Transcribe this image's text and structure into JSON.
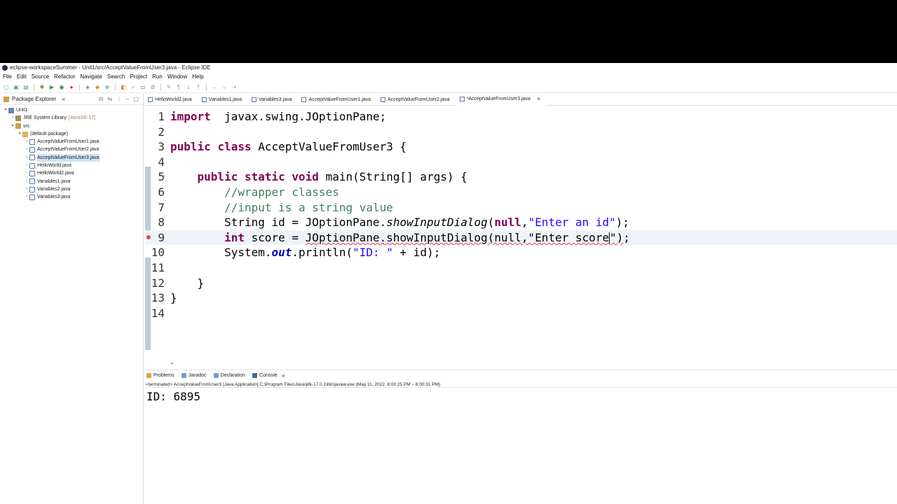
{
  "window": {
    "title": "eclipse-workspaceSummer - Unit1/src/AcceptValueFromUser3.java - Eclipse IDE"
  },
  "menu": [
    "File",
    "Edit",
    "Source",
    "Refactor",
    "Navigate",
    "Search",
    "Project",
    "Run",
    "Window",
    "Help"
  ],
  "explorer": {
    "title": "Package Explorer",
    "tree": [
      {
        "label": "Unit1",
        "indent": 0,
        "arrow": "▾",
        "icon": "project-icon"
      },
      {
        "label": "JRE System Library",
        "note": "[JavaSE-17]",
        "indent": 1,
        "arrow": "›",
        "icon": "library-icon"
      },
      {
        "label": "src",
        "indent": 1,
        "arrow": "▾",
        "icon": "source-folder-icon"
      },
      {
        "label": "(default package)",
        "indent": 2,
        "arrow": "▾",
        "icon": "package-icon"
      },
      {
        "label": "AcceptValueFromUser1.java",
        "indent": 3,
        "arrow": "›",
        "icon": "java-file-icon"
      },
      {
        "label": "AcceptValueFromUser2.java",
        "indent": 3,
        "arrow": "›",
        "icon": "java-file-icon"
      },
      {
        "label": "AcceptValueFromUser3.java",
        "indent": 3,
        "arrow": "›",
        "icon": "java-file-icon",
        "selected": true
      },
      {
        "label": "HelloWorld.java",
        "indent": 3,
        "arrow": "›",
        "icon": "java-file-icon"
      },
      {
        "label": "HelloWorld2.java",
        "indent": 3,
        "arrow": "›",
        "icon": "java-file-icon"
      },
      {
        "label": "Variables1.java",
        "indent": 3,
        "arrow": "›",
        "icon": "java-file-icon"
      },
      {
        "label": "Variables2.java",
        "indent": 3,
        "arrow": "›",
        "icon": "java-file-icon"
      },
      {
        "label": "Variables3.java",
        "indent": 3,
        "arrow": "›",
        "icon": "java-file-icon"
      }
    ]
  },
  "editor_tabs": [
    {
      "label": "HelloWorld2.java",
      "active": false
    },
    {
      "label": "Variables1.java",
      "active": false
    },
    {
      "label": "Variables3.java",
      "active": false
    },
    {
      "label": "AcceptValueFromUser1.java",
      "active": false
    },
    {
      "label": "AcceptValueFromUser2.java",
      "active": false
    },
    {
      "label": "*AcceptValueFromUser3.java",
      "active": true
    }
  ],
  "code": {
    "current_line": 9,
    "error_line": 9,
    "lines": [
      {
        "n": "1",
        "tokens": [
          [
            "kw",
            "import"
          ],
          [
            "",
            "  javax.swing.JOptionPane;"
          ]
        ]
      },
      {
        "n": "2",
        "tokens": []
      },
      {
        "n": "3",
        "tokens": [
          [
            "kw",
            "public"
          ],
          [
            "",
            " "
          ],
          [
            "kw",
            "class"
          ],
          [
            "",
            " AcceptValueFromUser3 {"
          ]
        ]
      },
      {
        "n": "4",
        "tokens": []
      },
      {
        "n": "5",
        "fold": true,
        "tokens": [
          [
            "",
            "    "
          ],
          [
            "kw",
            "public"
          ],
          [
            "",
            " "
          ],
          [
            "kw",
            "static"
          ],
          [
            "",
            " "
          ],
          [
            "kw",
            "void"
          ],
          [
            "",
            " main(String[] args) {"
          ]
        ]
      },
      {
        "n": "6",
        "tokens": [
          [
            "",
            "        "
          ],
          [
            "cm",
            "//wrapper classes"
          ]
        ]
      },
      {
        "n": "7",
        "tokens": [
          [
            "",
            "        "
          ],
          [
            "cm",
            "//input is a string value"
          ]
        ]
      },
      {
        "n": "8",
        "tokens": [
          [
            "",
            "        String id = JOptionPane."
          ],
          [
            "it",
            "showInputDialog"
          ],
          [
            "",
            "("
          ],
          [
            "kw",
            "null"
          ],
          [
            "",
            ","
          ],
          [
            "st",
            "\"Enter an id\""
          ],
          [
            "",
            ");"
          ]
        ]
      },
      {
        "n": "9",
        "tokens": [
          [
            "",
            "        "
          ],
          [
            "kw",
            "int"
          ],
          [
            "",
            " score = "
          ],
          [
            "squig",
            "JOptionPane.showInputDialog(null,\"Enter score"
          ],
          [
            "caret",
            ""
          ],
          [
            "squig",
            "\")"
          ],
          [
            "",
            ";"
          ]
        ]
      },
      {
        "n": "10",
        "tokens": [
          [
            "",
            "        System."
          ],
          [
            "fd",
            "out"
          ],
          [
            "",
            ".println("
          ],
          [
            "st",
            "\"ID: \""
          ],
          [
            "",
            " + id);"
          ]
        ]
      },
      {
        "n": "11",
        "tokens": []
      },
      {
        "n": "12",
        "tokens": [
          [
            "",
            "    }"
          ]
        ]
      },
      {
        "n": "13",
        "tokens": [
          [
            "",
            "}"
          ]
        ]
      },
      {
        "n": "14",
        "tokens": []
      }
    ]
  },
  "console_tabs": [
    {
      "label": "Problems",
      "icon": "problems-icon",
      "color": "#d9a441"
    },
    {
      "label": "Javadoc",
      "icon": "javadoc-icon",
      "color": "#7a9cc6"
    },
    {
      "label": "Declaration",
      "icon": "declaration-icon",
      "color": "#7a9cc6"
    },
    {
      "label": "Console",
      "icon": "console-icon",
      "color": "#4a6a8a",
      "active": true
    }
  ],
  "console": {
    "status": "<terminated> AcceptValueFromUser3 [Java Application] C:\\Program Files\\Java\\jdk-17.0.1\\bin\\javaw.exe  (May 11, 2022, 8:00:25 PM – 8:00:31 PM)",
    "output": "ID: 6895"
  }
}
